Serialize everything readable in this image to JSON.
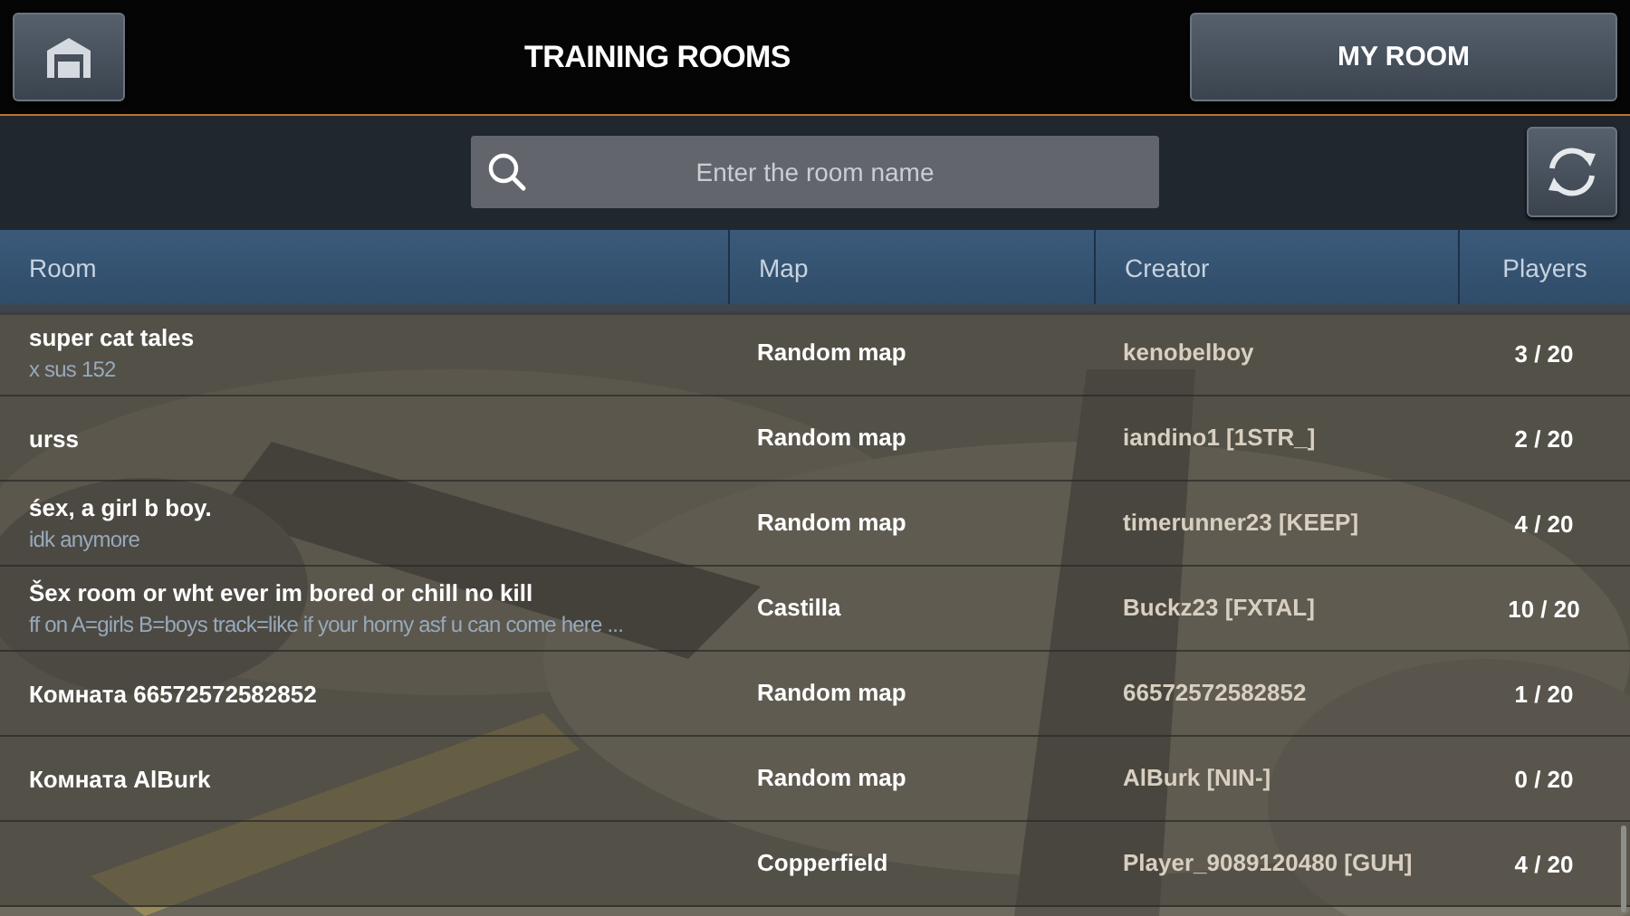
{
  "top_bar": {
    "title": "TRAINING ROOMS",
    "my_room_button": "MY ROOM"
  },
  "search": {
    "placeholder": "Enter the room name"
  },
  "table": {
    "columns": [
      "Room",
      "Map",
      "Creator",
      "Players"
    ],
    "rows": [
      {
        "name": "super cat tales",
        "description": "x sus 152",
        "map": "Random map",
        "creator": "kenobelboy",
        "players": "3 / 20"
      },
      {
        "name": "urss",
        "map": "Random map",
        "creator": "iandino1 [1STR_]",
        "players": "2 / 20"
      },
      {
        "name": "śex, a girl b boy.",
        "description": "idk anymore",
        "map": "Random map",
        "creator": "timerunner23 [KEEP]",
        "players": "4 / 20"
      },
      {
        "name": "Šex room or wht ever im bored or chill no kill",
        "description": "ff on A=girls B=boys track=like if your horny asf u can come here ...",
        "map": "Castilla",
        "creator": "Buckz23 [FXTAL]",
        "players": "10 / 20"
      },
      {
        "name": "Комната 66572572582852",
        "map": "Random map",
        "creator": "66572572582852",
        "players": "1 / 20"
      },
      {
        "name": "Комната AlBurk",
        "map": "Random map",
        "creator": "AlBurk [NIN-]",
        "players": "0 / 20"
      },
      {
        "map": "Copperfield",
        "creator": "Player_9089120480 [GUH]",
        "players": "4 / 20"
      }
    ]
  }
}
